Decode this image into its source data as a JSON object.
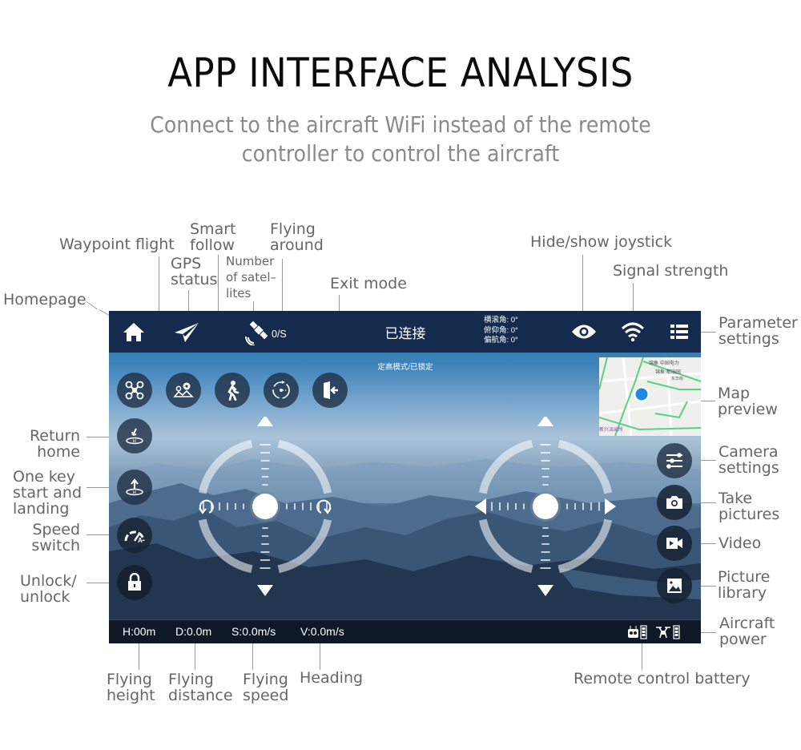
{
  "header": {
    "title": "APP INTERFACE ANALYSIS",
    "subtitle_line1": "Connect to the aircraft WiFi instead of the remote",
    "subtitle_line2": "controller to control the aircraft"
  },
  "annotations": {
    "homepage": "Homepage",
    "waypoint_flight": "Waypoint flight",
    "gps_status_1": "GPS",
    "gps_status_2": "status",
    "smart_follow_1": "Smart",
    "smart_follow_2": "follow",
    "satellites_1": "Number",
    "satellites_2": "of satel–",
    "satellites_3": "lites",
    "flying_around_1": "Flying",
    "flying_around_2": "around",
    "exit_mode": "Exit mode",
    "hide_show_joystick": "Hide/show joystick",
    "signal_strength": "Signal strength",
    "parameter_settings_1": "Parameter",
    "parameter_settings_2": "settings",
    "map_preview_1": "Map",
    "map_preview_2": "preview",
    "camera_settings_1": "Camera",
    "camera_settings_2": "settings",
    "take_pictures_1": "Take",
    "take_pictures_2": "pictures",
    "video": "Video",
    "picture_library_1": "Picture",
    "picture_library_2": "library",
    "aircraft_power_1": "Aircraft",
    "aircraft_power_2": "power",
    "return_home_1": "Return",
    "return_home_2": "home",
    "one_key_1": "One key",
    "one_key_2": "start and",
    "one_key_3": "landing",
    "speed_switch_1": "Speed",
    "speed_switch_2": "switch",
    "unlock_1": "Unlock/",
    "unlock_2": "unlock",
    "flying_height_1": "Flying",
    "flying_height_2": "height",
    "flying_distance_1": "Flying",
    "flying_distance_2": "distance",
    "flying_speed_1": "Flying",
    "flying_speed_2": "speed",
    "heading": "Heading",
    "remote_control_battery": "Remote control battery"
  },
  "app": {
    "topbar": {
      "connection_status": "已连接",
      "satellite_count": "0/S",
      "attitude": {
        "roll": "横滚角:  0°",
        "pitch": "俯仰角:  0°",
        "yaw": "偏航角:  0°"
      },
      "icons": [
        "home-icon",
        "paper-plane-icon",
        "satellite-icon",
        "eye-icon",
        "wifi-icon",
        "menu-list-icon"
      ]
    },
    "flight_mode": "定高模式/已锁定",
    "mode_buttons": [
      "drone-icon",
      "waypoint-map-icon",
      "follow-runner-icon",
      "orbit-icon",
      "exit-door-icon"
    ],
    "left_buttons": [
      "return-home-icon",
      "takeoff-landing-icon",
      "speedometer-icon",
      "lock-icon"
    ],
    "right_buttons": [
      "sliders-icon",
      "camera-icon",
      "video-icon",
      "image-gallery-icon"
    ],
    "telemetry": {
      "height": "H:00m",
      "distance": "D:0.0m",
      "speed": "S:0.0m/s",
      "vertical_speed": "V:0.0m/s"
    },
    "colors": {
      "topbar": "#142b4d",
      "map_dot": "#1e88e5",
      "map_road": "#5ccf86"
    }
  }
}
